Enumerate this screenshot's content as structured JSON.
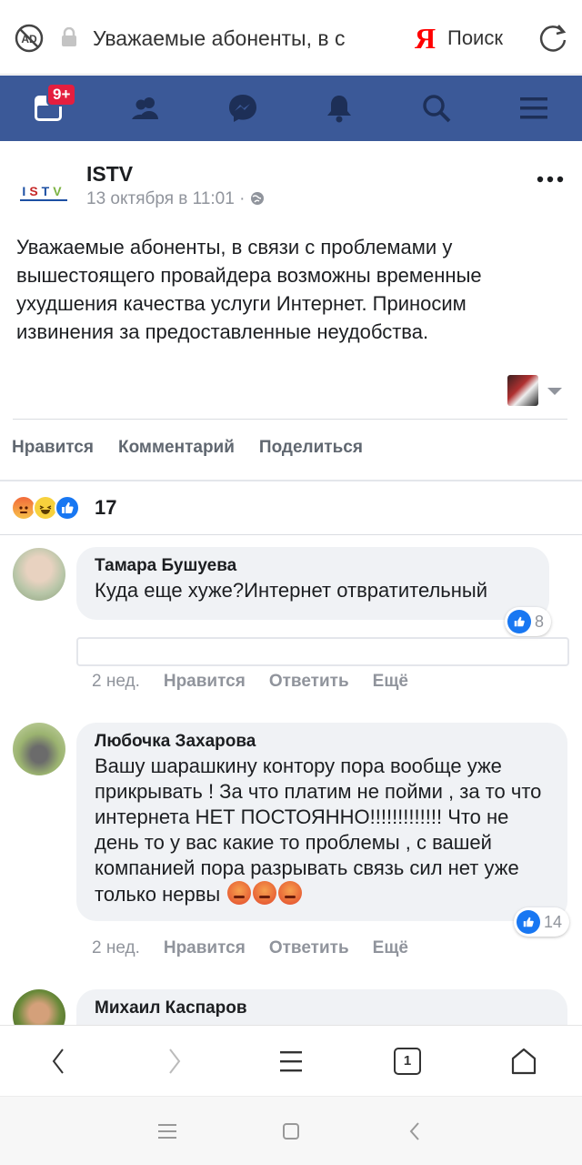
{
  "browser": {
    "url_text": "Уважаемые абоненты, в с",
    "yandex_logo": "Я",
    "search_label": "Поиск"
  },
  "fbnav": {
    "notifications_badge": "9+"
  },
  "post": {
    "author": "ISTV",
    "time": "13 октября в 11:01 · ",
    "text": "Уважаемые абоненты, в связи с проблемами у вышестоящего провайдера возможны временные ухудшения качества услуги Интернет. Приносим извинения за предоставленные неудобства.",
    "actions": [
      "Нравится",
      "Комментарий",
      "Поделиться"
    ],
    "reactions_count": "17"
  },
  "comments": [
    {
      "name": "Тамара Бушуева",
      "text": "Куда еще хуже?Интернет отвратительный",
      "likes": "8",
      "age": "2 нед.",
      "like_label": "Нравится",
      "reply_label": "Ответить",
      "more_label": "Ещё"
    },
    {
      "name": "Любочка Захарова",
      "text": "Вашу шарашкину контору пора вообще уже прикрывать ! За что платим не пойми , за то что интернета НЕТ ПОСТОЯННО!!!!!!!!!!!!! Что не день то у вас какие то проблемы , с вашей компанией пора разрывать связь сил нет уже только нервы",
      "likes": "14",
      "age": "2 нед.",
      "like_label": "Нравится",
      "reply_label": "Ответить",
      "more_label": "Ещё"
    },
    {
      "name": "Михаил Каспаров"
    }
  ],
  "bottom_bar": {
    "tabs_count": "1"
  },
  "colors": {
    "facebook_blue": "#3b5998",
    "badge_red": "#e41e3f",
    "like_blue": "#1877f2"
  }
}
